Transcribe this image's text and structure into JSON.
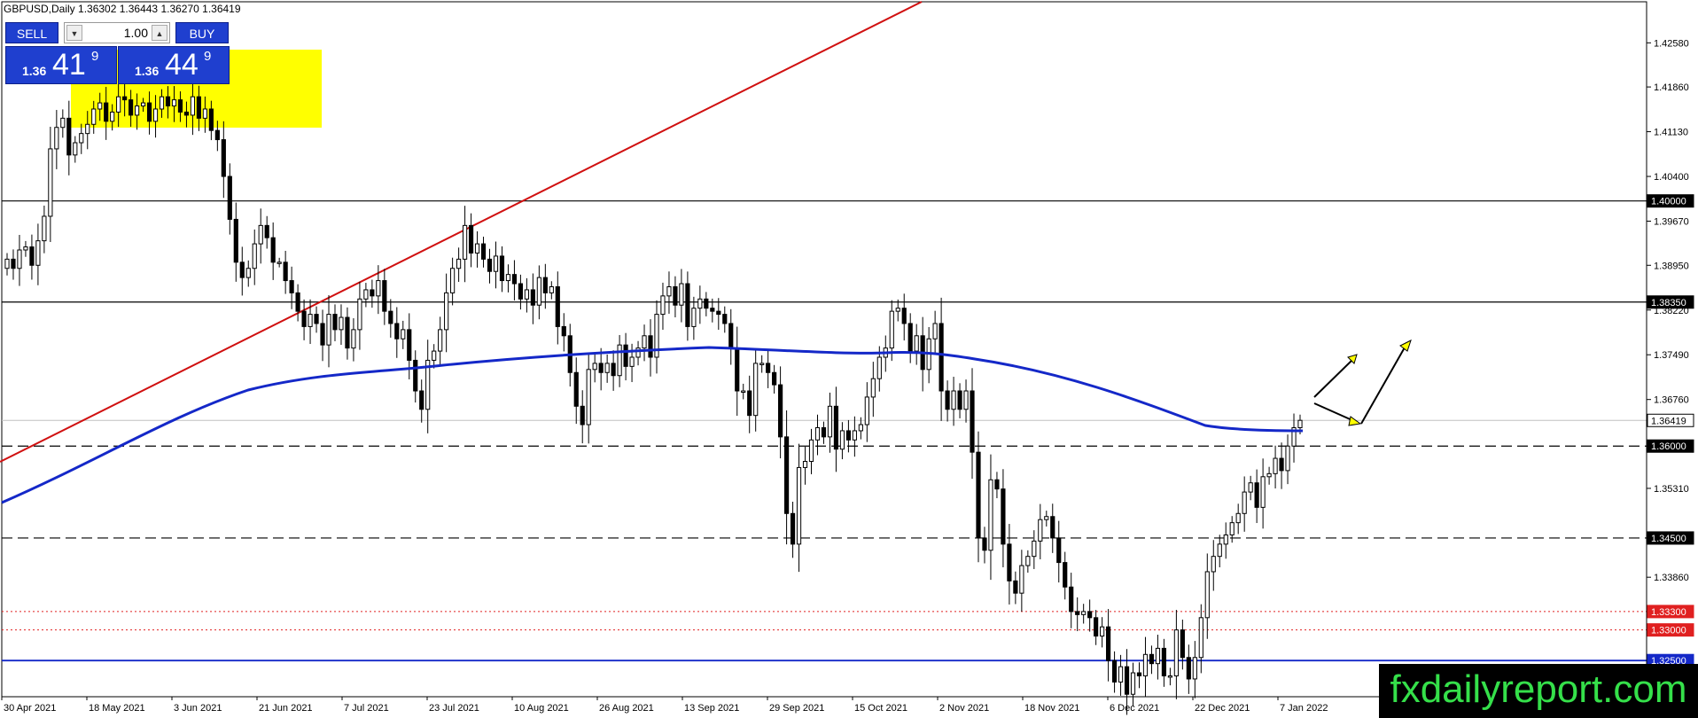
{
  "header": {
    "text": "GBPUSD,Daily  1.36302 1.36443 1.36270 1.36419"
  },
  "trade_panel": {
    "sell_label": "SELL",
    "buy_label": "BUY",
    "lot": "1.00",
    "sell_small": "1.36",
    "sell_big": "41",
    "sell_sup": "9",
    "buy_small": "1.36",
    "buy_big": "44",
    "buy_sup": "9"
  },
  "watermark": "fxdailyreport.com",
  "colors": {
    "background": "#ffffff",
    "candle": "#000000",
    "ma_line": "#1428c8",
    "trendline": "#d01010",
    "highlight_zone": "#ffff00",
    "level_blue": "#1428c8",
    "level_red": "#e02020",
    "prediction_arrow": "#ffff00"
  },
  "chart_data": {
    "type": "candlestick",
    "symbol": "GBPUSD",
    "timeframe": "Daily",
    "ohlc_current": {
      "open": 1.36302,
      "high": 1.36443,
      "low": 1.3627,
      "close": 1.36419
    },
    "y_axis": {
      "range": [
        1.3191,
        1.4325
      ],
      "ticks": [
        "1.42580",
        "1.41860",
        "1.41130",
        "1.40400",
        "1.39670",
        "1.38950",
        "1.38220",
        "1.37490",
        "1.36760",
        "1.35310",
        "1.33860"
      ]
    },
    "x_axis": {
      "ticks": [
        "30 Apr 2021",
        "18 May 2021",
        "3 Jun 2021",
        "21 Jun 2021",
        "7 Jul 2021",
        "23 Jul 2021",
        "10 Aug 2021",
        "26 Aug 2021",
        "13 Sep 2021",
        "29 Sep 2021",
        "15 Oct 2021",
        "2 Nov 2021",
        "18 Nov 2021",
        "6 Dec 2021",
        "22 Dec 2021",
        "7 Jan 2022"
      ]
    },
    "levels": [
      {
        "label": "1.40000",
        "value": 1.4,
        "style": "solid",
        "color": "#000000"
      },
      {
        "label": "1.38350",
        "value": 1.3835,
        "style": "solid",
        "color": "#000000"
      },
      {
        "label": "1.36419",
        "value": 1.36419,
        "style": "solid-light",
        "color": "#c0c0c0"
      },
      {
        "label": "1.36000",
        "value": 1.36,
        "style": "dashed",
        "color": "#000000"
      },
      {
        "label": "1.34500",
        "value": 1.345,
        "style": "dashed",
        "color": "#000000"
      },
      {
        "label": "1.33300",
        "value": 1.333,
        "style": "dotted",
        "color": "#e02020"
      },
      {
        "label": "1.33000",
        "value": 1.33,
        "style": "dotted",
        "color": "#e02020"
      },
      {
        "label": "1.32500",
        "value": 1.325,
        "style": "solid",
        "color": "#1428c8"
      }
    ],
    "candles_close": [
      1.3905,
      1.389,
      1.392,
      1.3925,
      1.3895,
      1.3935,
      1.3975,
      1.4085,
      1.412,
      1.4135,
      1.4075,
      1.4095,
      1.411,
      1.4125,
      1.415,
      1.416,
      1.413,
      1.4145,
      1.417,
      1.4165,
      1.414,
      1.4155,
      1.416,
      1.413,
      1.415,
      1.417,
      1.4155,
      1.4165,
      1.4145,
      1.414,
      1.417,
      1.4135,
      1.415,
      1.4115,
      1.41,
      1.404,
      1.397,
      1.39,
      1.3875,
      1.389,
      1.393,
      1.396,
      1.394,
      1.39,
      1.39,
      1.387,
      1.385,
      1.382,
      1.3795,
      1.3815,
      1.38,
      1.3765,
      1.3815,
      1.379,
      1.381,
      1.376,
      1.379,
      1.384,
      1.3855,
      1.3845,
      1.387,
      1.382,
      1.38,
      1.3775,
      1.379,
      1.374,
      1.369,
      1.366,
      1.374,
      1.3755,
      1.379,
      1.385,
      1.389,
      1.3905,
      1.396,
      1.3915,
      1.393,
      1.3905,
      1.3885,
      1.391,
      1.387,
      1.388,
      1.3865,
      1.384,
      1.3855,
      1.383,
      1.3875,
      1.385,
      1.386,
      1.3795,
      1.378,
      1.372,
      1.3665,
      1.3635,
      1.3725,
      1.3735,
      1.372,
      1.3735,
      1.3715,
      1.3765,
      1.373,
      1.3745,
      1.376,
      1.378,
      1.3745,
      1.3815,
      1.3845,
      1.386,
      1.383,
      1.3865,
      1.3795,
      1.3825,
      1.384,
      1.3825,
      1.382,
      1.3815,
      1.38,
      1.376,
      1.369,
      1.369,
      1.365,
      1.3735,
      1.3735,
      1.372,
      1.37,
      1.3615,
      1.349,
      1.344,
      1.3565,
      1.3575,
      1.361,
      1.363,
      1.3615,
      1.3665,
      1.3595,
      1.3625,
      1.361,
      1.3625,
      1.3635,
      1.368,
      1.371,
      1.3745,
      1.376,
      1.382,
      1.3825,
      1.38,
      1.3755,
      1.378,
      1.3725,
      1.3775,
      1.38,
      1.369,
      1.366,
      1.369,
      1.366,
      1.369,
      1.359,
      1.345,
      1.343,
      1.3545,
      1.353,
      1.344,
      1.338,
      1.336,
      1.3405,
      1.342,
      1.3445,
      1.348,
      1.3485,
      1.345,
      1.341,
      1.337,
      1.333,
      1.3325,
      1.333,
      1.332,
      1.329,
      1.3305,
      1.325,
      1.3215,
      1.324,
      1.3195,
      1.323,
      1.3225,
      1.326,
      1.3245,
      1.327,
      1.3225,
      1.3225,
      1.33,
      1.3255,
      1.322,
      1.3255,
      1.332,
      1.3395,
      1.342,
      1.344,
      1.3455,
      1.3475,
      1.349,
      1.3525,
      1.354,
      1.35,
      1.355,
      1.3555,
      1.358,
      1.356,
      1.36,
      1.363,
      1.3642
    ]
  }
}
